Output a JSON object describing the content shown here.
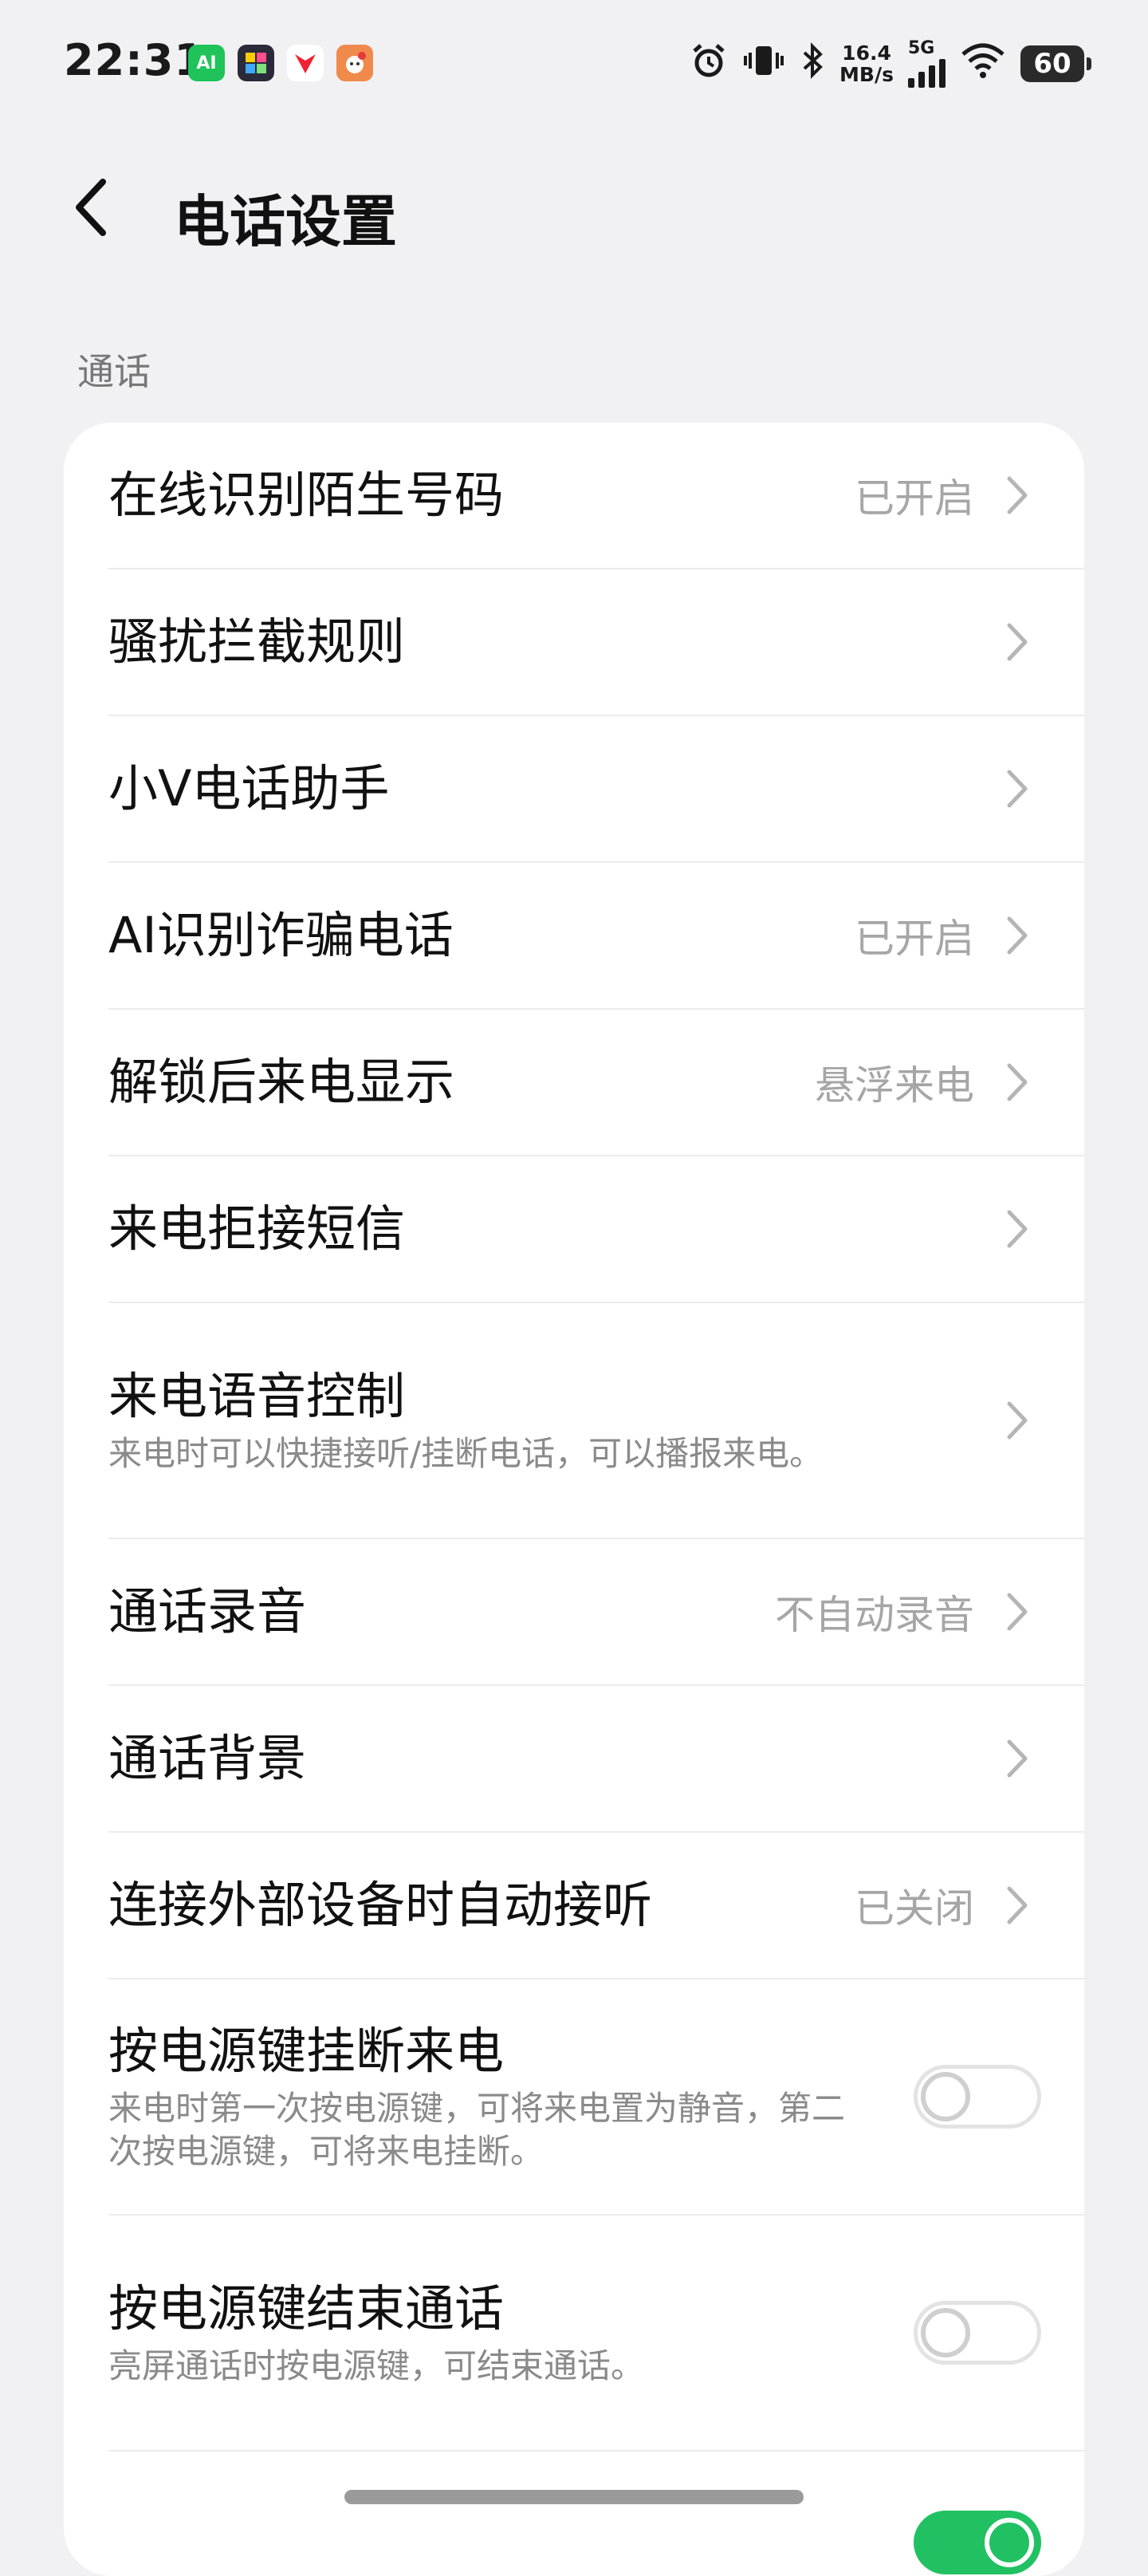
{
  "status_bar": {
    "time": "22:31",
    "apps": [
      {
        "icon": "ai-app-icon",
        "label": "AI",
        "color": "#1fc35a"
      },
      {
        "icon": "colorful-app-icon",
        "label": "",
        "color": "#2a2a3a"
      },
      {
        "icon": "red-arrow-app-icon",
        "label": "",
        "color": "#ffffff"
      },
      {
        "icon": "mascot-app-icon",
        "label": "",
        "color": "#f08a4b"
      }
    ],
    "net_speed_value": "16.4",
    "net_speed_unit": "MB/s",
    "network_type": "5G",
    "battery": "60"
  },
  "header": {
    "title": "电话设置"
  },
  "section": {
    "label": "通话"
  },
  "settings": [
    {
      "title": "在线识别陌生号码",
      "value": "已开启",
      "control": "chevron"
    },
    {
      "title": "骚扰拦截规则",
      "value": "",
      "control": "chevron"
    },
    {
      "title": "小V电话助手",
      "value": "",
      "control": "chevron"
    },
    {
      "title": "AI识别诈骗电话",
      "value": "已开启",
      "control": "chevron"
    },
    {
      "title": "解锁后来电显示",
      "value": "悬浮来电",
      "control": "chevron"
    },
    {
      "title": "来电拒接短信",
      "value": "",
      "control": "chevron"
    },
    {
      "title": "来电语音控制",
      "subtitle": "来电时可以快捷接听/挂断电话，可以播报来电。",
      "value": "",
      "control": "chevron"
    },
    {
      "title": "通话录音",
      "value": "不自动录音",
      "control": "chevron"
    },
    {
      "title": "通话背景",
      "value": "",
      "control": "chevron"
    },
    {
      "title": "连接外部设备时自动接听",
      "value": "已关闭",
      "control": "chevron"
    },
    {
      "title": "按电源键挂断来电",
      "subtitle": "来电时第一次按电源键，可将来电置为静音，第二次按电源键，可将来电挂断。",
      "control": "toggle",
      "on": false
    },
    {
      "title": "按电源键结束通话",
      "subtitle": "亮屏通话时按电源键，可结束通话。",
      "control": "toggle",
      "on": false
    }
  ],
  "colors": {
    "toggle_on": "#21c163",
    "background": "#f1f1f3"
  }
}
